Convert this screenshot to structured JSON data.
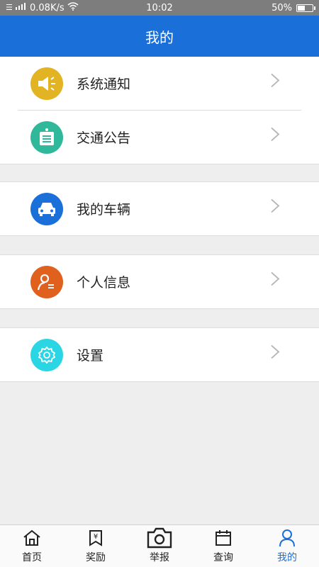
{
  "status_bar": {
    "network_speed": "0.08K/s",
    "time": "10:02",
    "battery": "50%",
    "battery_level": 0.5
  },
  "header": {
    "title": "我的"
  },
  "menu": {
    "items": [
      {
        "label": "系统通知",
        "icon": "megaphone-icon",
        "color": "#e2b322"
      },
      {
        "label": "交通公告",
        "icon": "notice-board-icon",
        "color": "#2fb89a"
      },
      {
        "label": "我的车辆",
        "icon": "car-icon",
        "color": "#1a6fd9"
      },
      {
        "label": "个人信息",
        "icon": "person-info-icon",
        "color": "#e0601e"
      },
      {
        "label": "设置",
        "icon": "gear-icon",
        "color": "#2ad6e3"
      }
    ]
  },
  "bottom_nav": {
    "items": [
      {
        "label": "首页",
        "icon": "home-icon"
      },
      {
        "label": "奖励",
        "icon": "reward-icon"
      },
      {
        "label": "举报",
        "icon": "camera-icon"
      },
      {
        "label": "查询",
        "icon": "calendar-icon"
      },
      {
        "label": "我的",
        "icon": "user-icon"
      }
    ],
    "active_color": "#1a6fd9"
  }
}
